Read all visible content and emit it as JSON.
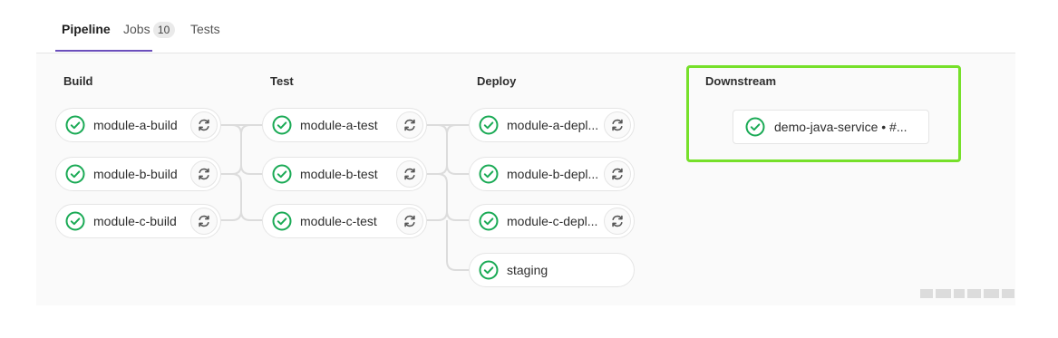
{
  "tabs": {
    "pipeline": "Pipeline",
    "jobs": "Jobs",
    "jobs_count": "10",
    "tests": "Tests"
  },
  "stages": [
    {
      "title": "Build",
      "jobs": [
        "module-a-build",
        "module-b-build",
        "module-c-build"
      ]
    },
    {
      "title": "Test",
      "jobs": [
        "module-a-test",
        "module-b-test",
        "module-c-test"
      ]
    },
    {
      "title": "Deploy",
      "jobs": [
        "module-a-depl...",
        "module-b-depl...",
        "module-c-depl...",
        "staging"
      ]
    },
    {
      "title": "Downstream",
      "jobs": [
        "demo-java-service • #..."
      ]
    }
  ],
  "colors": {
    "success": "#1aaa55",
    "highlight": "#76e02a",
    "active_tab": "#6b4fbb"
  },
  "icons": {
    "status": "check-circle-icon",
    "retry": "retry-icon"
  }
}
